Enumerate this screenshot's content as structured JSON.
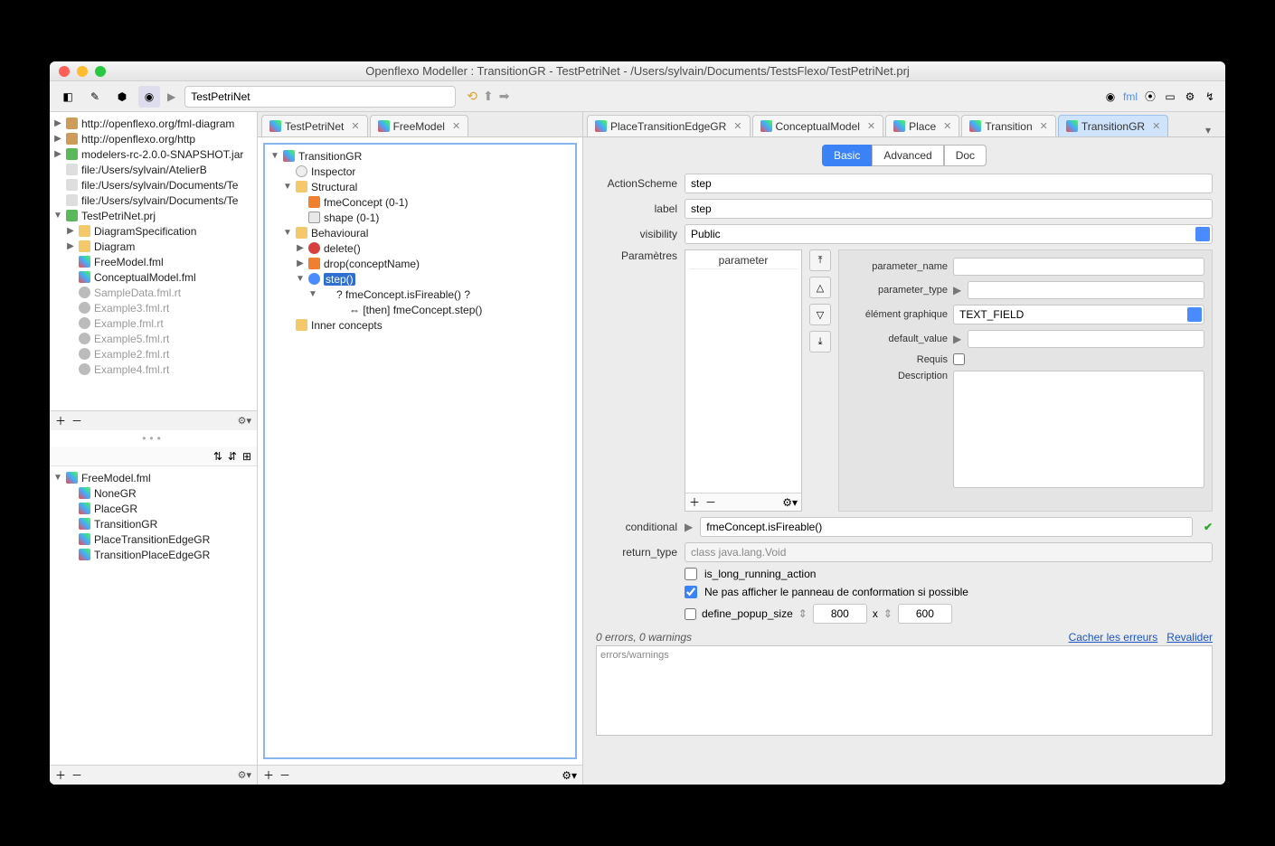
{
  "window_title": "Openflexo Modeller : TransitionGR - TestPetriNet - /Users/sylvain/Documents/TestsFlexo/TestPetriNet.prj",
  "breadcrumb": "TestPetriNet",
  "left_browser": [
    {
      "ind": 0,
      "tw": "▶",
      "icon": "ic-pkg",
      "label": "http://openflexo.org/fml-diagram"
    },
    {
      "ind": 0,
      "tw": "▶",
      "icon": "ic-pkg",
      "label": "http://openflexo.org/http"
    },
    {
      "ind": 0,
      "tw": "▶",
      "icon": "ic-green",
      "label": "modelers-rc-2.0.0-SNAPSHOT.jar"
    },
    {
      "ind": 0,
      "tw": "",
      "icon": "ic-file",
      "label": "file:/Users/sylvain/AtelierB"
    },
    {
      "ind": 0,
      "tw": "",
      "icon": "ic-file",
      "label": "file:/Users/sylvain/Documents/Te"
    },
    {
      "ind": 0,
      "tw": "",
      "icon": "ic-file",
      "label": "file:/Users/sylvain/Documents/Te"
    },
    {
      "ind": 0,
      "tw": "▼",
      "icon": "ic-green",
      "label": "TestPetriNet.prj"
    },
    {
      "ind": 1,
      "tw": "▶",
      "icon": "ic-folder",
      "label": "DiagramSpecification"
    },
    {
      "ind": 1,
      "tw": "▶",
      "icon": "ic-folder",
      "label": "Diagram"
    },
    {
      "ind": 1,
      "tw": "",
      "icon": "ic-diamond",
      "label": "FreeModel.fml"
    },
    {
      "ind": 1,
      "tw": "",
      "icon": "ic-diamond",
      "label": "ConceptualModel.fml"
    },
    {
      "ind": 1,
      "tw": "",
      "icon": "ic-grey",
      "label": "SampleData.fml.rt",
      "dim": true
    },
    {
      "ind": 1,
      "tw": "",
      "icon": "ic-grey",
      "label": "Example3.fml.rt",
      "dim": true
    },
    {
      "ind": 1,
      "tw": "",
      "icon": "ic-grey",
      "label": "Example.fml.rt",
      "dim": true
    },
    {
      "ind": 1,
      "tw": "",
      "icon": "ic-grey",
      "label": "Example5.fml.rt",
      "dim": true
    },
    {
      "ind": 1,
      "tw": "",
      "icon": "ic-grey",
      "label": "Example2.fml.rt",
      "dim": true
    },
    {
      "ind": 1,
      "tw": "",
      "icon": "ic-grey",
      "label": "Example4.fml.rt",
      "dim": true
    }
  ],
  "left_model": [
    {
      "ind": 0,
      "tw": "▼",
      "icon": "ic-diamond",
      "label": "FreeModel.fml"
    },
    {
      "ind": 1,
      "tw": "",
      "icon": "ic-diamond",
      "label": "NoneGR"
    },
    {
      "ind": 1,
      "tw": "",
      "icon": "ic-diamond",
      "label": "PlaceGR"
    },
    {
      "ind": 1,
      "tw": "",
      "icon": "ic-diamond",
      "label": "TransitionGR"
    },
    {
      "ind": 1,
      "tw": "",
      "icon": "ic-diamond",
      "label": "PlaceTransitionEdgeGR"
    },
    {
      "ind": 1,
      "tw": "",
      "icon": "ic-diamond",
      "label": "TransitionPlaceEdgeGR"
    }
  ],
  "mid_tabs": [
    {
      "label": "TestPetriNet",
      "active": false
    },
    {
      "label": "FreeModel",
      "active": false
    }
  ],
  "right_tabs": [
    {
      "label": "PlaceTransitionEdgeGR",
      "active": false
    },
    {
      "label": "ConceptualModel",
      "active": false
    },
    {
      "label": "Place",
      "active": false
    },
    {
      "label": "Transition",
      "active": false
    },
    {
      "label": "TransitionGR",
      "active": true
    }
  ],
  "outline": [
    {
      "ind": 0,
      "tw": "▼",
      "icon": "ic-diamond",
      "label": "TransitionGR"
    },
    {
      "ind": 1,
      "tw": "",
      "icon": "ic-mag",
      "label": "Inspector"
    },
    {
      "ind": 1,
      "tw": "▼",
      "icon": "ic-folder",
      "label": "Structural"
    },
    {
      "ind": 2,
      "tw": "",
      "icon": "ic-orange",
      "label": "fmeConcept (0-1)"
    },
    {
      "ind": 2,
      "tw": "",
      "icon": "ic-shape",
      "label": "shape (0-1)"
    },
    {
      "ind": 1,
      "tw": "▼",
      "icon": "ic-folder",
      "label": "Behavioural"
    },
    {
      "ind": 2,
      "tw": "▶",
      "icon": "ic-red",
      "label": "delete()"
    },
    {
      "ind": 2,
      "tw": "▶",
      "icon": "ic-orange",
      "label": "drop(conceptName)"
    },
    {
      "ind": 2,
      "tw": "▼",
      "icon": "ic-blue",
      "label": "step()",
      "sel": true
    },
    {
      "ind": 3,
      "tw": "▼",
      "icon": "",
      "label": "?  fmeConcept.isFireable() ?"
    },
    {
      "ind": 4,
      "tw": "",
      "icon": "",
      "label": "⇔ [then] fmeConcept.step()"
    },
    {
      "ind": 1,
      "tw": "",
      "icon": "ic-folder",
      "label": "Inner concepts"
    }
  ],
  "seg": {
    "basic": "Basic",
    "advanced": "Advanced",
    "doc": "Doc"
  },
  "form": {
    "action_scheme": {
      "label": "ActionScheme",
      "value": "step"
    },
    "label": {
      "label": "label",
      "value": "step"
    },
    "visibility": {
      "label": "visibility",
      "value": "Public"
    },
    "params_label": "Paramètres",
    "param_header": "parameter",
    "pf": {
      "name": {
        "label": "parameter_name",
        "value": ""
      },
      "type": {
        "label": "parameter_type",
        "value": ""
      },
      "widget": {
        "label": "élément graphique",
        "value": "TEXT_FIELD"
      },
      "default": {
        "label": "default_value",
        "value": ""
      },
      "required": {
        "label": "Requis"
      },
      "desc": {
        "label": "Description"
      }
    },
    "conditional": {
      "label": "conditional",
      "value": "fmeConcept.isFireable()"
    },
    "return_type": {
      "label": "return_type",
      "value": "class java.lang.Void"
    },
    "long_running": "is_long_running_action",
    "hide_panel": "Ne pas afficher le panneau de conformation si  possible",
    "define_popup": "define_popup_size",
    "popup_w": "800",
    "popup_x": "x",
    "popup_h": "600"
  },
  "errors": {
    "summary": "0 errors, 0 warnings",
    "hide": "Cacher les erreurs",
    "revalidate": "Revalider",
    "placeholder": "errors/warnings"
  }
}
